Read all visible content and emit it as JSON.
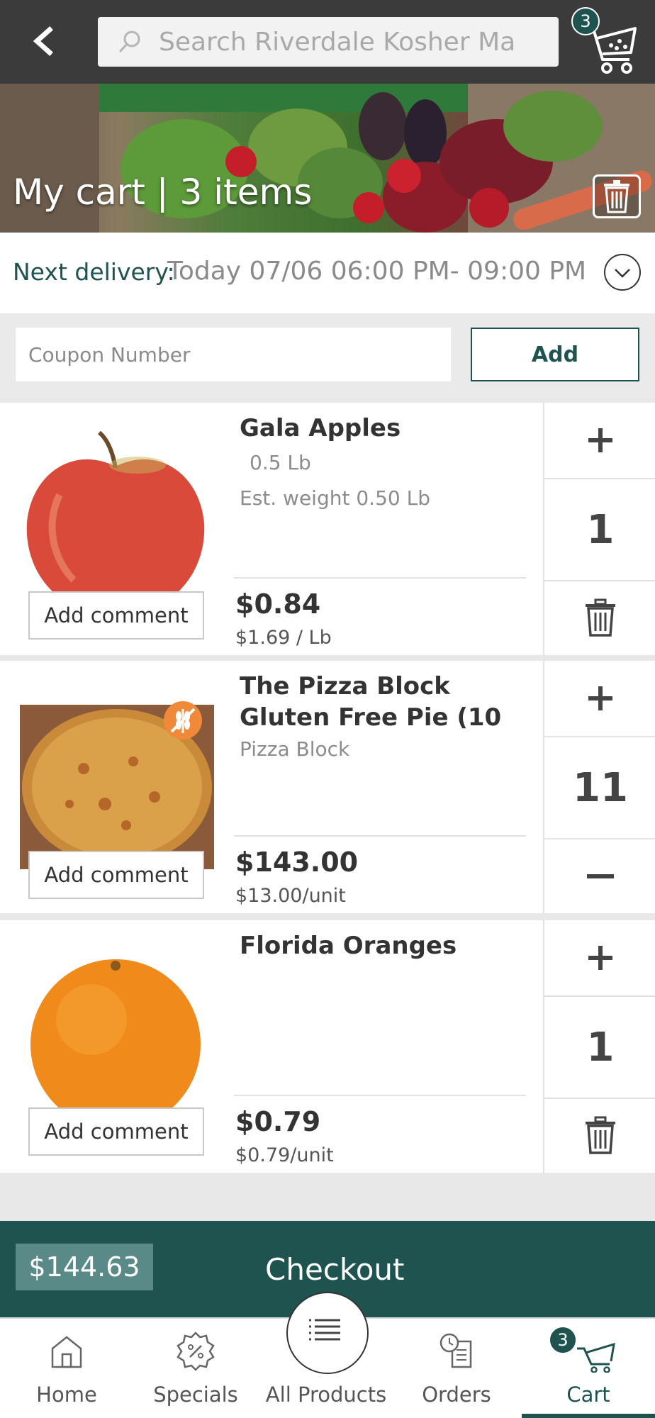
{
  "header": {
    "search_placeholder": "Search Riverdale Kosher Ma",
    "cart_count": "3"
  },
  "banner": {
    "title": "My cart | 3 items"
  },
  "delivery": {
    "label": "Next delivery:",
    "value": "Today 07/06 06:00 PM- 09:00 PM"
  },
  "coupon": {
    "placeholder": "Coupon Number",
    "add_label": "Add"
  },
  "items": [
    {
      "name": "Gala Apples",
      "sub1": "0.5 Lb",
      "sub2": "Est. weight 0.50 Lb",
      "price": "$0.84",
      "unit_price": "$1.69 / Lb",
      "qty": "1",
      "comment_label": "Add comment"
    },
    {
      "name": "The Pizza Block Gluten Free Pie (10",
      "sub1": "Pizza Block",
      "price": "$143.00",
      "unit_price": "$13.00/unit",
      "qty": "11",
      "comment_label": "Add comment"
    },
    {
      "name": "Florida Oranges",
      "price": "$0.79",
      "unit_price": "$0.79/unit",
      "qty": "1",
      "comment_label": "Add comment"
    }
  ],
  "checkout": {
    "total": "$144.63",
    "label": "Checkout"
  },
  "nav": {
    "home": "Home",
    "specials": "Specials",
    "all_products": "All Products",
    "orders": "Orders",
    "cart": "Cart",
    "cart_count": "3"
  },
  "colors": {
    "brand": "#1e5350",
    "topbar": "#3b3b3b"
  }
}
